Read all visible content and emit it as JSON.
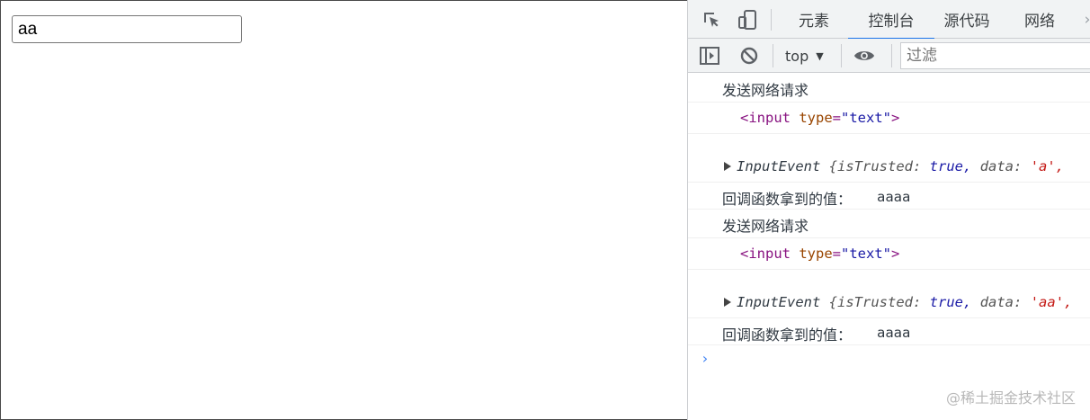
{
  "page": {
    "input_value": "aa"
  },
  "devtools": {
    "tabs": [
      {
        "label": "元素"
      },
      {
        "label": "控制台"
      },
      {
        "label": "源代码"
      },
      {
        "label": "网络"
      }
    ],
    "active_tab": "控制台",
    "toolbar": {
      "context": "top",
      "filter_placeholder": "过滤"
    },
    "colors": {
      "accent": "#1a73e8",
      "tag": "#881280",
      "attr": "#994500",
      "string": "#c41a16",
      "keyword": "#1a1aa6"
    }
  },
  "console": {
    "group1": {
      "send_text": "发送网络请求",
      "el_open": "<input",
      "el_attr": "type",
      "el_eq": "=",
      "el_val": "\"text\"",
      "el_close": ">",
      "evt_name": "InputEvent",
      "evt_open": "{isTrusted:",
      "evt_true": "true,",
      "evt_data_key": "data:",
      "evt_data_val": "'a',",
      "cb_label": "回调函数拿到的值：",
      "cb_value": "aaaa"
    },
    "group2": {
      "send_text": "发送网络请求",
      "el_open": "<input",
      "el_attr": "type",
      "el_eq": "=",
      "el_val": "\"text\"",
      "el_close": ">",
      "evt_name": "InputEvent",
      "evt_open": "{isTrusted:",
      "evt_true": "true,",
      "evt_data_key": "data:",
      "evt_data_val": "'aa',",
      "cb_label": "回调函数拿到的值：",
      "cb_value": "aaaa"
    },
    "prompt": "›"
  },
  "watermark": "@稀土掘金技术社区"
}
